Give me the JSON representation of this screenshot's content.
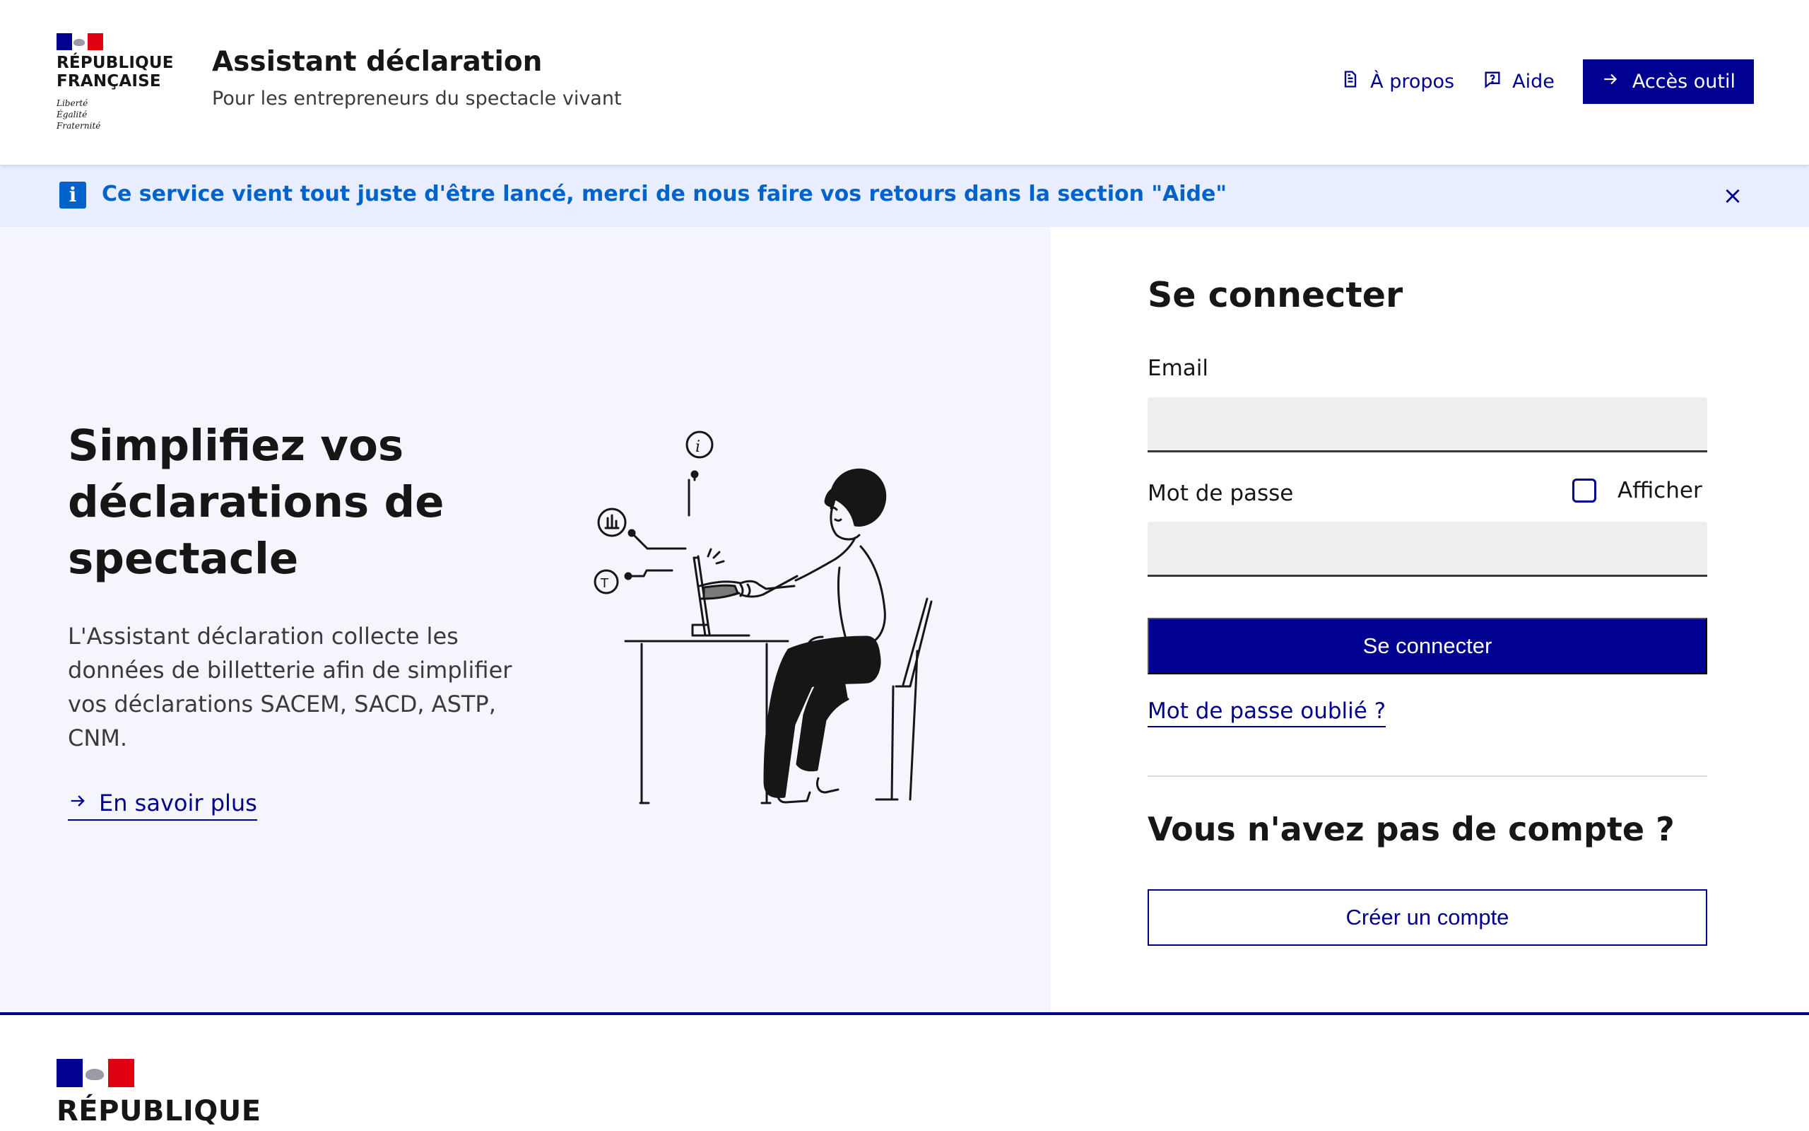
{
  "header": {
    "logo_lines": [
      "RÉPUBLIQUE",
      "FRANÇAISE"
    ],
    "motto": [
      "Liberté",
      "Égalité",
      "Fraternité"
    ],
    "service_title": "Assistant déclaration",
    "service_tagline": "Pour les entrepreneurs du spectacle vivant",
    "tools": {
      "about": "À propos",
      "help": "Aide",
      "access": "Accès outil"
    }
  },
  "notice": {
    "text": "Ce service vient tout juste d'être lancé, merci de nous faire vos retours dans la section \"Aide\"",
    "close_icon": "×"
  },
  "stray_text": ";",
  "hero": {
    "title": "Simplifiez vos déclarations de spectacle",
    "description": "L'Assistant déclaration collecte les données de billetterie afin de simplifier vos déclarations SACEM, SACD, ASTP, CNM.",
    "link": "En savoir plus"
  },
  "login": {
    "title": "Se connecter",
    "email_label": "Email",
    "email_value": "",
    "password_label": "Mot de passe",
    "password_value": "",
    "show_password": "Afficher",
    "submit": "Se connecter",
    "forgot": "Mot de passe oublié ?",
    "no_account_title": "Vous n'avez pas de compte ?",
    "create_account": "Créer un compte"
  },
  "footer": {
    "logo_line": "RÉPUBLIQUE"
  },
  "colors": {
    "primary": "#000091",
    "info": "#0063cb",
    "notice_bg": "#e8edff",
    "hero_bg": "#f5f5fe"
  }
}
